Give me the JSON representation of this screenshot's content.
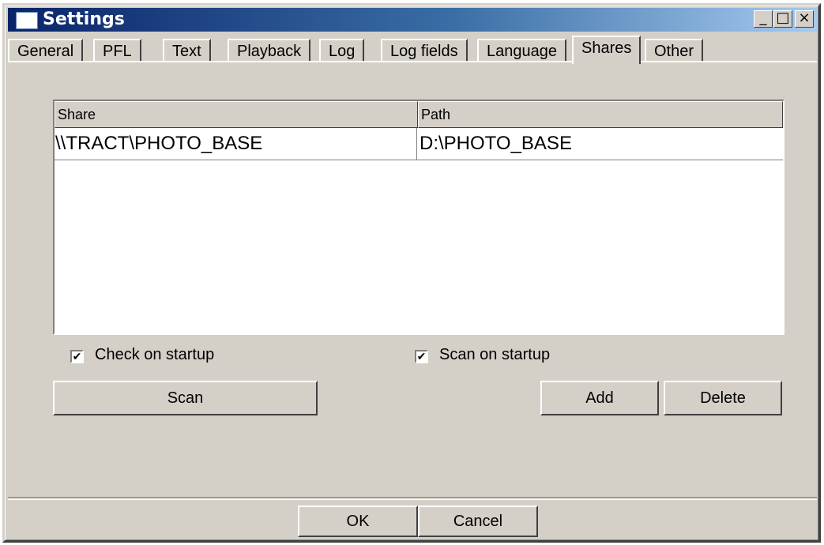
{
  "window": {
    "title": "Settings",
    "controls": {
      "minimize": "_",
      "maximize": "□",
      "close": "×"
    }
  },
  "tabs": [
    {
      "label": "General"
    },
    {
      "label": "PFL"
    },
    {
      "label": "Text"
    },
    {
      "label": "Playback"
    },
    {
      "label": "Log"
    },
    {
      "label": "Log fields"
    },
    {
      "label": "Language"
    },
    {
      "label": "Shares",
      "active": true
    },
    {
      "label": "Other"
    }
  ],
  "shares": {
    "columns": [
      "Share",
      "Path"
    ],
    "rows": [
      {
        "share": "\\\\TRACT\\PHOTO_BASE",
        "path": "D:\\PHOTO_BASE"
      }
    ],
    "check_on_startup": {
      "label": "Check on startup",
      "checked": true
    },
    "scan_on_startup": {
      "label": "Scan on startup",
      "checked": true
    },
    "buttons": {
      "scan": "Scan",
      "add": "Add",
      "delete": "Delete"
    }
  },
  "footer": {
    "ok": "OK",
    "cancel": "Cancel"
  },
  "icons": {
    "window_icon": "window-icon",
    "check_mark": "✔"
  }
}
